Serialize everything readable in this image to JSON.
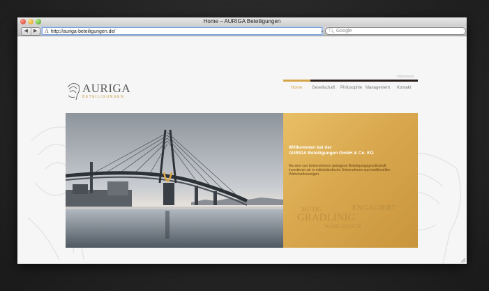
{
  "window": {
    "title": "Home – AURIGA Beteiligungen"
  },
  "toolbar": {
    "back_label": "◀",
    "forward_label": "▶",
    "url": "http://auriga-beteiligungen.de/",
    "reload_label": "⌄",
    "search_placeholder": "Google"
  },
  "site": {
    "logo_text": "AURIGA",
    "logo_subtext": "BETEILIGUNGEN",
    "language_link": "Impressum",
    "menu": [
      {
        "label": "Home",
        "active": true
      },
      {
        "label": "Gesellschaft",
        "active": false
      },
      {
        "label": "Philosophie",
        "active": false
      },
      {
        "label": "Management",
        "active": false
      },
      {
        "label": "Kontakt",
        "active": false
      }
    ],
    "hero": {
      "title_line1": "Willkommen bei der",
      "title_line2": "AURIGA Beteiligungen GmbH & Co. KG",
      "text": "Als eine von Unternehmern getragene Beteiligungsgesellschaft investieren wir in mittelständische Unternehmen aus traditionellen Wirtschaftszweigen.",
      "values": [
        "MUTIG",
        "ENGAGIERT",
        "GRADLINIG",
        "WÄHLERISCH"
      ]
    }
  },
  "colors": {
    "accent_gold": "#d5a448",
    "menu_bar_dark": "#2a1f18"
  }
}
